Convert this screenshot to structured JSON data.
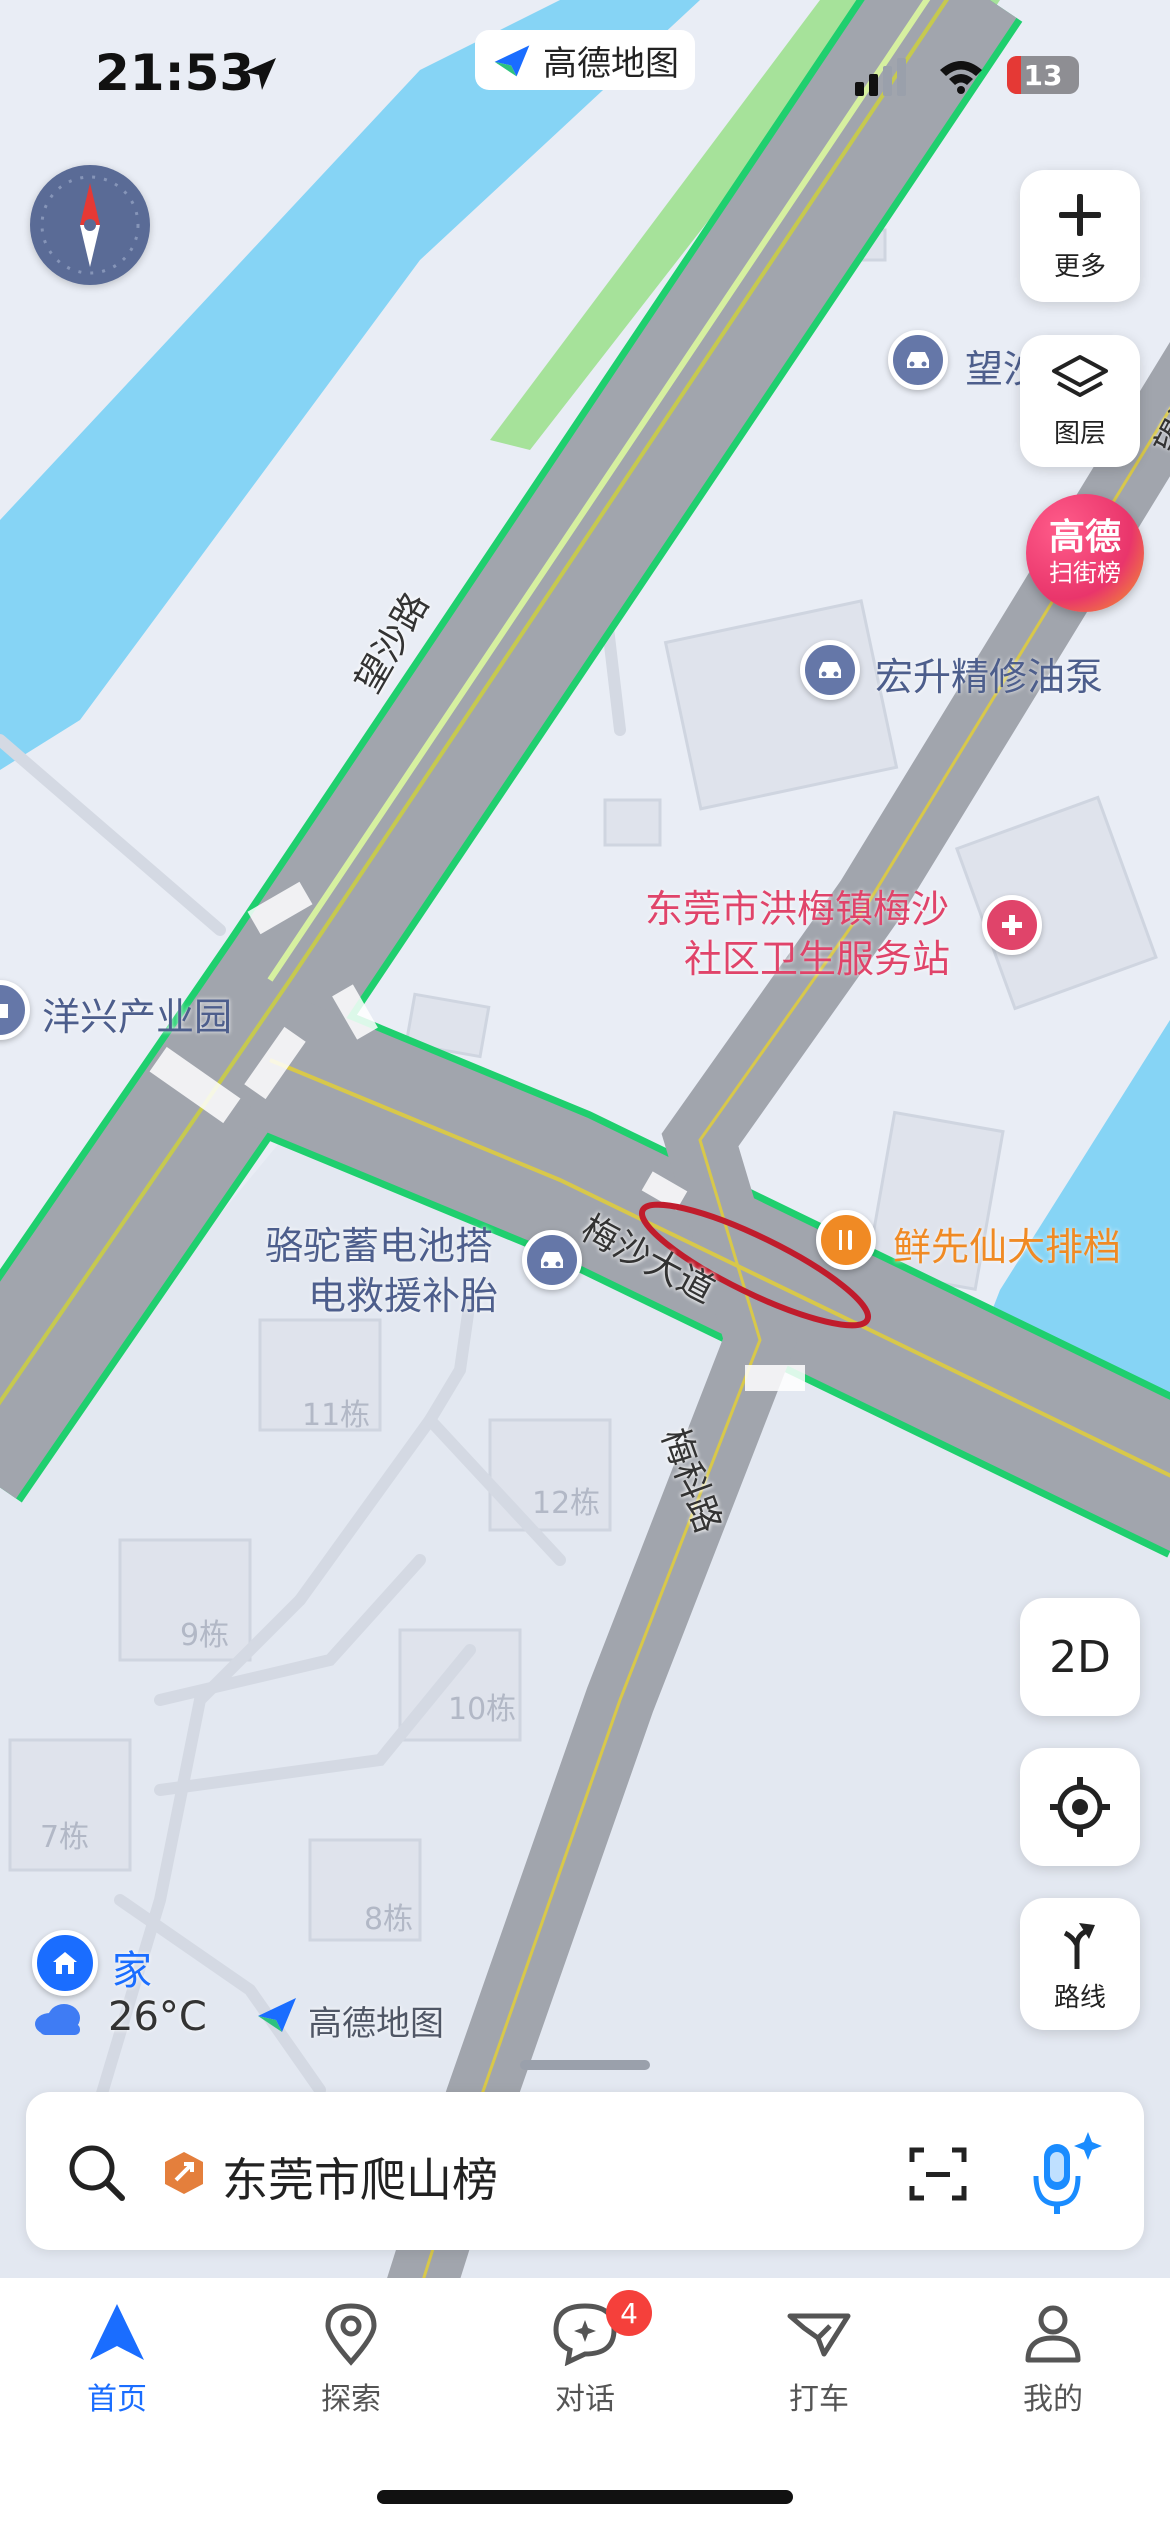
{
  "status_bar": {
    "time": "21:53",
    "battery": "13"
  },
  "brand": {
    "name": "高德地图"
  },
  "map": {
    "roads": {
      "wangsha": "望沙路",
      "meisha": "梅沙大道",
      "meike": "梅科路",
      "wangsha_top": "望沙路"
    },
    "pois": {
      "gas_station": "宏升精修油泵",
      "clinic_line1": "东莞市洪梅镇梅沙",
      "clinic_line2": "社区卫生服务站",
      "industrial_park": "洋兴产业园",
      "battery_line1": "骆驼蓄电池搭",
      "battery_line2": "电救援补胎",
      "restaurant": "鲜先仙大排档",
      "top_right_truncated": "望沙"
    },
    "buildings": [
      "11栋",
      "12栋",
      "9栋",
      "10栋",
      "7栋",
      "8栋"
    ],
    "home_label": "家",
    "weather": "26°C",
    "watermark": "高德地图"
  },
  "side_controls": {
    "more": "更多",
    "layers": "图层",
    "street_rank_line1": "高德",
    "street_rank_line2": "扫街榜",
    "view_mode": "2D",
    "route": "路线"
  },
  "search": {
    "value": "东莞市爬山榜"
  },
  "tabs": [
    {
      "label": "首页",
      "active": true
    },
    {
      "label": "探索",
      "active": false
    },
    {
      "label": "对话",
      "active": false,
      "badge": "4"
    },
    {
      "label": "打车",
      "active": false
    },
    {
      "label": "我的",
      "active": false
    }
  ],
  "colors": {
    "accent": "#1a6dff",
    "poi_red": "#e0446a",
    "food_orange": "#f08a24",
    "badge_red": "#f5403b"
  }
}
